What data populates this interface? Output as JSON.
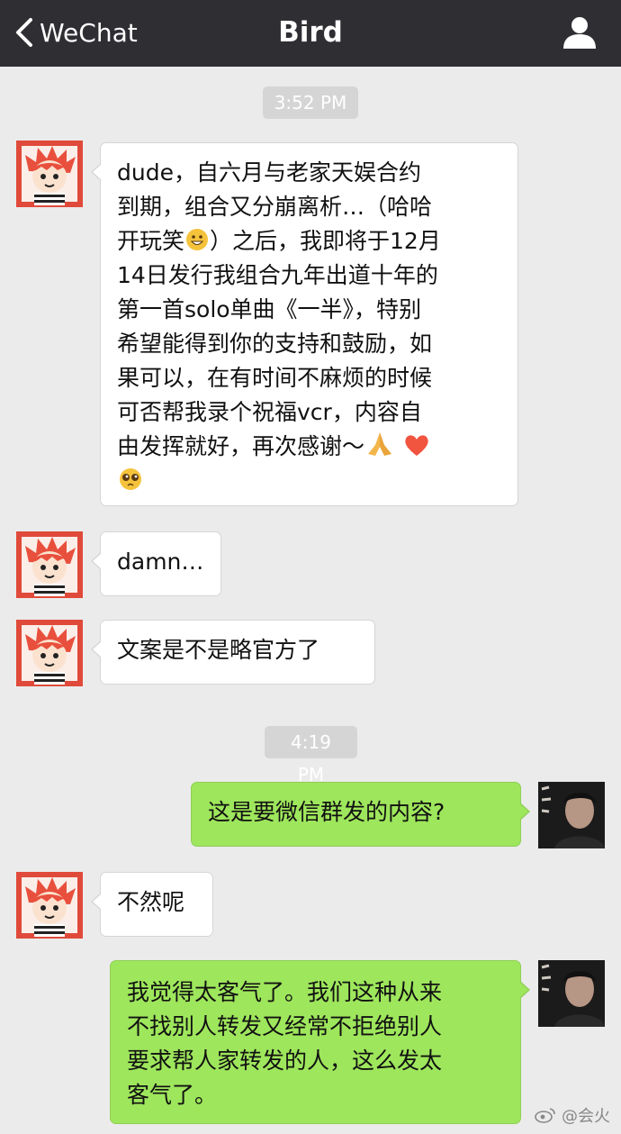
{
  "navbar": {
    "back_label": "WeChat",
    "title": "Bird"
  },
  "timestamps": [
    "3:52 PM",
    "4:19 PM"
  ],
  "messages": [
    {
      "side": "in",
      "text_lines": [
        "dude，自六月与老家天娱合约",
        "到期，组合又分崩离析…（哈哈",
        "开玩笑",
        "）之后，我即将于12月",
        "14日发行我组合九年出道十年的",
        "第一首solo单曲《一半》，特别",
        "希望能得到你的支持和鼓励，如",
        "果可以，在有时间不麻烦的时候",
        "可否帮我录个祝福vcr，内容自",
        "由发挥就好，再次感谢～"
      ],
      "emojis": [
        "grinning-face-emoji",
        "folded-hands-emoji",
        "red-heart-emoji",
        "pleading-face-emoji"
      ]
    },
    {
      "side": "in",
      "text": "damn…"
    },
    {
      "side": "in",
      "text": "文案是不是略官方了"
    },
    {
      "side": "out",
      "text": "这是要微信群发的内容?"
    },
    {
      "side": "in",
      "text": "不然呢"
    },
    {
      "side": "out",
      "text_lines": [
        "我觉得太客气了。我们这种从来",
        "不找别人转发又经常不拒绝别人",
        "要求帮人家转发的人，这么发太",
        "客气了。"
      ]
    }
  ],
  "watermark": {
    "text": "@会火"
  },
  "colors": {
    "navbar_bg": "#2f2e33",
    "chat_bg": "#ebebeb",
    "incoming_bubble": "#ffffff",
    "outgoing_bubble": "#9ee65c",
    "timestamp_bg": "#d5d5d5"
  }
}
